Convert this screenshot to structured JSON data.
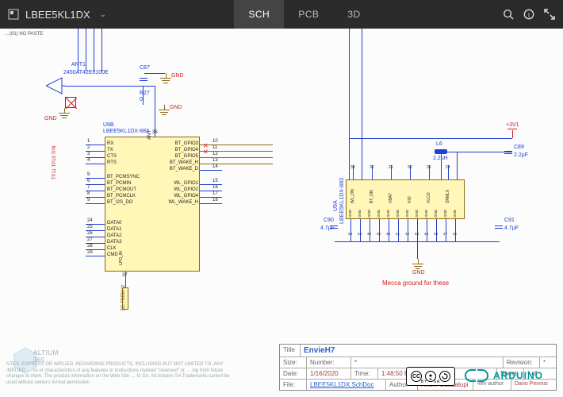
{
  "header": {
    "doc_name": "LBEE5KL1DX",
    "tabs": {
      "sch": "SCH",
      "pcb": "PCB",
      "three_d": "3D"
    }
  },
  "schematic": {
    "top_frag": "…(81) NO PASTE",
    "antenna": {
      "designator": "ANT1",
      "part": "2450AT42E0100E"
    },
    "resistor": {
      "designator": "R27",
      "value": "0"
    },
    "caps": {
      "c87": {
        "designator": "C87",
        "net": "GND"
      },
      "c89": {
        "designator": "C89",
        "value": "2.2µF"
      },
      "c90": {
        "designator": "C90",
        "value": "4.7µF"
      },
      "c91": {
        "designator": "C91",
        "value": "4.7µF"
      }
    },
    "gnd_label": "GND",
    "power_rail": "+3V1",
    "inductor": {
      "designator": "L6",
      "value": "2.2uH"
    },
    "chip_main": {
      "designator": "U9B",
      "part": "LBEE5KL1DX-883",
      "left_pins_a": [
        {
          "num": "1",
          "name": "RX"
        },
        {
          "num": "2",
          "name": "TX"
        },
        {
          "num": "3",
          "name": "CTS"
        },
        {
          "num": "4",
          "name": "RTS"
        }
      ],
      "left_pins_b": [
        {
          "num": "5",
          "name": "BT_PCMSYNC"
        },
        {
          "num": "6",
          "name": "BT_PCMIN"
        },
        {
          "num": "7",
          "name": "BT_PCMOUT"
        },
        {
          "num": "8",
          "name": "BT_PCMCLK"
        },
        {
          "num": "9",
          "name": "BT_I2S_DO"
        }
      ],
      "left_pins_c": [
        {
          "num": "24",
          "name": "DATA0"
        },
        {
          "num": "25",
          "name": "DATA1"
        },
        {
          "num": "26",
          "name": "DATA2"
        },
        {
          "num": "27",
          "name": "DATA3"
        },
        {
          "num": "28",
          "name": "CLK"
        },
        {
          "num": "29",
          "name": "CMD"
        }
      ],
      "right_pins_a": [
        {
          "num": "10",
          "name": "BT_GPIO3"
        },
        {
          "num": "11",
          "name": "BT_GPIO4"
        },
        {
          "num": "12",
          "name": "BT_GPIO5"
        },
        {
          "num": "13",
          "name": "BT_WAKE_H"
        },
        {
          "num": "14",
          "name": "BT_WAKE_D"
        }
      ],
      "right_pins_b": [
        {
          "num": "15",
          "name": "WL_GPIO1"
        },
        {
          "num": "16",
          "name": "WL_GPIO2"
        },
        {
          "num": "17",
          "name": "WL_GPIO4"
        },
        {
          "num": "18",
          "name": "WL_WAKE_H"
        }
      ],
      "top_pin": {
        "num": "35",
        "name": "ANT"
      },
      "bottom_pins": [
        {
          "num": "37",
          "name": "LPO_IN"
        }
      ]
    },
    "chip_right": {
      "designator": "U9A",
      "part": "LBEE5KL1DX-883",
      "top_pins": [
        {
          "num": "38",
          "name": "WL_ON"
        },
        {
          "num": "36",
          "name": "BT_ON"
        },
        {
          "num": "21",
          "name": "VBAT"
        },
        {
          "num": "30",
          "name": "VIO"
        },
        {
          "num": "31",
          "name": "VLCO"
        },
        {
          "num": "23",
          "name": "SRMLX"
        }
      ],
      "bottom_pins": [
        {
          "num": "33",
          "name": "GND"
        },
        {
          "num": "34",
          "name": "GND"
        },
        {
          "num": "46",
          "name": "GND"
        },
        {
          "num": "39",
          "name": "GND"
        },
        {
          "num": "40",
          "name": "GND"
        },
        {
          "num": "41",
          "name": "GND"
        },
        {
          "num": "42",
          "name": "GND"
        },
        {
          "num": "43",
          "name": "GND"
        },
        {
          "num": "44",
          "name": "GND"
        },
        {
          "num": "45",
          "name": "GND"
        },
        {
          "num": "47",
          "name": "GND"
        },
        {
          "num": "32",
          "name": "GND"
        }
      ]
    },
    "tp_labels": "TP11 TP10 TP8",
    "crystal_label": "32.768kHz",
    "mecca_note": "Mecca ground for these"
  },
  "titleblock": {
    "title_lbl": "Title",
    "title": "EnvieH7",
    "size_lbl": "Size:",
    "size": "",
    "number_lbl": "Number:",
    "number": "",
    "revision_lbl": "Revision:",
    "revision": "",
    "date_lbl": "Date:",
    "date": "1/16/2020",
    "time_lbl": "Time:",
    "time": "1:48:50 PM",
    "sheet_lbl": "Sheet",
    "sheet": "*   of",
    "file_lbl": "File:",
    "file": "LBEE5KL1DX.SchDoc",
    "author_lbl": "Author",
    "author": "Arium Guadalupi",
    "rev_author_lbl": "Rev author",
    "rev_author": "Dario Pennisi"
  },
  "footer": {
    "cc": {
      "by": "BY",
      "sa": "SA"
    },
    "arduino": "ARDUINO",
    "altium_365": "ALTIUM\n365",
    "disclaimer": "NTES, EXPRESS OR IMPLIED, REGARDING PRODUCTS, INCLUDING BUT NOT LIMITED TO, ANY IMPLIED … ce or characteristics of any features or instructions marked \"reserved\" or … ing from future changes to them. The product information on the Web Site … to SA. All Arduino SA Trademarks cannot be used without owner's formal permission."
  }
}
